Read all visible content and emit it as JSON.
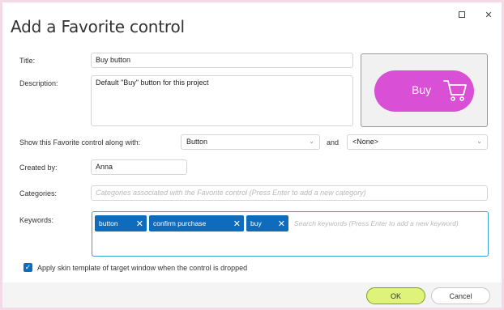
{
  "dialog": {
    "title": "Add a Favorite control",
    "maximize_icon": "maximize-icon",
    "close_label": "✕"
  },
  "form": {
    "title_label": "Title:",
    "title_value": "Buy button",
    "description_label": "Description:",
    "description_value": "Default \"Buy\" button for this project",
    "show_along_label": "Show this Favorite control along with:",
    "show_along_value": "Button",
    "and_label": "and",
    "second_value": "<None>",
    "created_by_label": "Created by:",
    "created_by_value": "Anna",
    "categories_label": "Categories:",
    "categories_placeholder": "Categories associated with the Favorite control (Press Enter to add a new category)",
    "keywords_label": "Keywords:",
    "keywords": [
      "button",
      "confirm purchase",
      "buy"
    ],
    "keywords_placeholder": "Search keywords (Press Enter to add a new keyword)",
    "apply_skin_label": "Apply skin template of target window when the control is dropped",
    "apply_skin_checked": true
  },
  "preview": {
    "button_label": "Buy",
    "button_color": "#d94fd6",
    "icon": "shopping-cart-icon"
  },
  "footer": {
    "ok_label": "OK",
    "cancel_label": "Cancel"
  },
  "colors": {
    "accent": "#0f6cbd",
    "ok_button": "#dff27a"
  }
}
